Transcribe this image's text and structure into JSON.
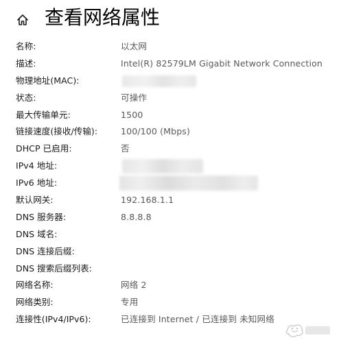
{
  "header": {
    "title": "查看网络属性",
    "home_icon": "home-icon"
  },
  "properties": [
    {
      "label": "名称:",
      "value": "以太网"
    },
    {
      "label": "描述:",
      "value": "Intel(R) 82579LM Gigabit Network Connection"
    },
    {
      "label": "物理地址(MAC):",
      "value": "",
      "redacted": true
    },
    {
      "label": "状态:",
      "value": "可操作"
    },
    {
      "label": "最大传输单元:",
      "value": "1500"
    },
    {
      "label": "链接速度(接收/传输):",
      "value": "100/100 (Mbps)"
    },
    {
      "label": "DHCP 已启用:",
      "value": "否"
    },
    {
      "label": "IPv4 地址:",
      "value": "",
      "redacted": true
    },
    {
      "label": "IPv6 地址:",
      "value": "",
      "redacted": true
    },
    {
      "label": "默认网关:",
      "value": "192.168.1.1"
    },
    {
      "label": "DNS 服务器:",
      "value": "8.8.8.8"
    },
    {
      "label": "DNS 域名:",
      "value": ""
    },
    {
      "label": "DNS 连接后缀:",
      "value": ""
    },
    {
      "label": "DNS 搜索后缀列表:",
      "value": ""
    },
    {
      "label": "网络名称:",
      "value": "网络 2"
    },
    {
      "label": "网络类别:",
      "value": "专用"
    },
    {
      "label": "连接性(IPv4/IPv6):",
      "value": "已连接到 Internet / 已连接到 未知网络"
    }
  ],
  "colors": {
    "label_text": "#1a1a1a",
    "value_text": "#595959",
    "background": "#ffffff"
  }
}
